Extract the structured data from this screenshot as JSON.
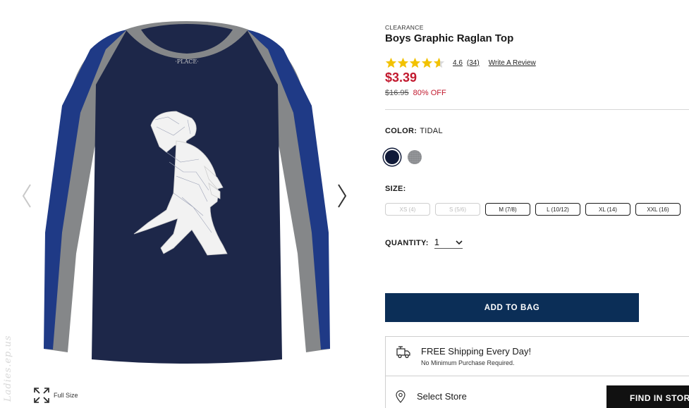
{
  "gallery": {
    "image_icon": "boys-raglan-tee-trex-image",
    "fullsize_label": "Full Size",
    "watermark": "Ladies.ep.us"
  },
  "product": {
    "eyebrow": "CLEARANCE",
    "title": "Boys Graphic Raglan Top",
    "rating_value": "4.6",
    "rating_stars": 4.6,
    "review_count": "(34)",
    "write_review": "Write A Review",
    "price": "$3.39",
    "old_price": "$16.95",
    "discount": "80% OFF"
  },
  "color": {
    "label": "COLOR:",
    "value": "TIDAL",
    "swatches": [
      {
        "name": "Tidal",
        "hex": "#101a38",
        "selected": true
      },
      {
        "name": "Heather Gray",
        "hex": "#8a8c8f",
        "selected": false
      }
    ]
  },
  "size": {
    "label": "SIZE:",
    "options": [
      {
        "label": "XS (4)",
        "available": false
      },
      {
        "label": "S (5/6)",
        "available": false
      },
      {
        "label": "M (7/8)",
        "available": true
      },
      {
        "label": "L (10/12)",
        "available": true
      },
      {
        "label": "XL (14)",
        "available": true
      },
      {
        "label": "XXL (16)",
        "available": true
      }
    ]
  },
  "quantity": {
    "label": "QUANTITY:",
    "value": "1"
  },
  "actions": {
    "add_to_bag": "ADD TO BAG",
    "find_in_store": "FIND IN STORE"
  },
  "shipping": {
    "title": "FREE Shipping Every Day!",
    "subtitle": "No Minimum Purchase Required."
  },
  "store": {
    "label": "Select Store"
  },
  "colors": {
    "price_red": "#c21a2f",
    "primary_navy": "#0b2e57",
    "star_gold": "#f2c200"
  }
}
